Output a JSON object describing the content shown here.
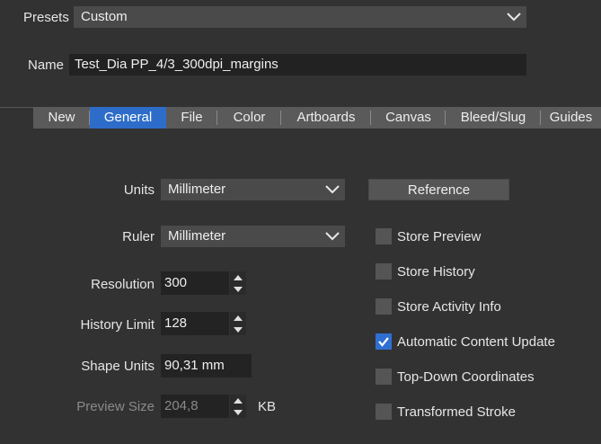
{
  "presets": {
    "label": "Presets",
    "value": "Custom"
  },
  "name": {
    "label": "Name",
    "value": "Test_Dia PP_4/3_300dpi_margins"
  },
  "tabs": [
    {
      "label": "New",
      "active": false
    },
    {
      "label": "General",
      "active": true
    },
    {
      "label": "File",
      "active": false
    },
    {
      "label": "Color",
      "active": false
    },
    {
      "label": "Artboards",
      "active": false
    },
    {
      "label": "Canvas",
      "active": false
    },
    {
      "label": "Bleed/Slug",
      "active": false
    },
    {
      "label": "Guides",
      "active": false
    }
  ],
  "general": {
    "units": {
      "label": "Units",
      "value": "Millimeter"
    },
    "ruler": {
      "label": "Ruler",
      "value": "Millimeter"
    },
    "resolution": {
      "label": "Resolution",
      "value": "300"
    },
    "history_limit": {
      "label": "History Limit",
      "value": "128"
    },
    "shape_units": {
      "label": "Shape Units",
      "value": "90,31 mm"
    },
    "preview_size": {
      "label": "Preview Size",
      "value": "204,8",
      "unit": "KB",
      "disabled": true
    },
    "reference_button": "Reference",
    "checkboxes": [
      {
        "label": "Store Preview",
        "checked": false
      },
      {
        "label": "Store History",
        "checked": false
      },
      {
        "label": "Store Activity Info",
        "checked": false
      },
      {
        "label": "Automatic Content Update",
        "checked": true
      },
      {
        "label": "Top-Down Coordinates",
        "checked": false
      },
      {
        "label": "Transformed Stroke",
        "checked": false
      }
    ]
  },
  "colors": {
    "accent": "#2d6dc9",
    "background": "#323232"
  }
}
